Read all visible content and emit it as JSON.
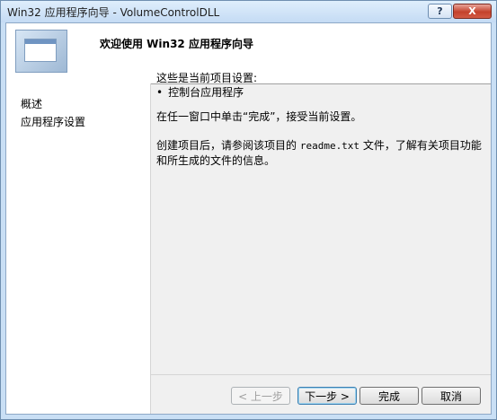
{
  "window": {
    "title": "Win32 应用程序向导 - VolumeControlDLL",
    "help_label": "?",
    "close_label": "X"
  },
  "banner": {
    "title": "欢迎使用 Win32 应用程序向导"
  },
  "nav": {
    "items": [
      {
        "label": "概述"
      },
      {
        "label": "应用程序设置"
      }
    ]
  },
  "content": {
    "heading": "这些是当前项目设置:",
    "bullet": "控制台应用程序",
    "instruction": "在任一窗口中单击“完成”，接受当前设置。",
    "info_before": "创建项目后，请参阅该项目的 ",
    "info_file": "readme.txt",
    "info_after": " 文件，了解有关项目功能和所生成的文件的信息。"
  },
  "buttons": {
    "prev": "< 上一步",
    "next": "下一步 >",
    "finish": "完成",
    "cancel": "取消"
  }
}
